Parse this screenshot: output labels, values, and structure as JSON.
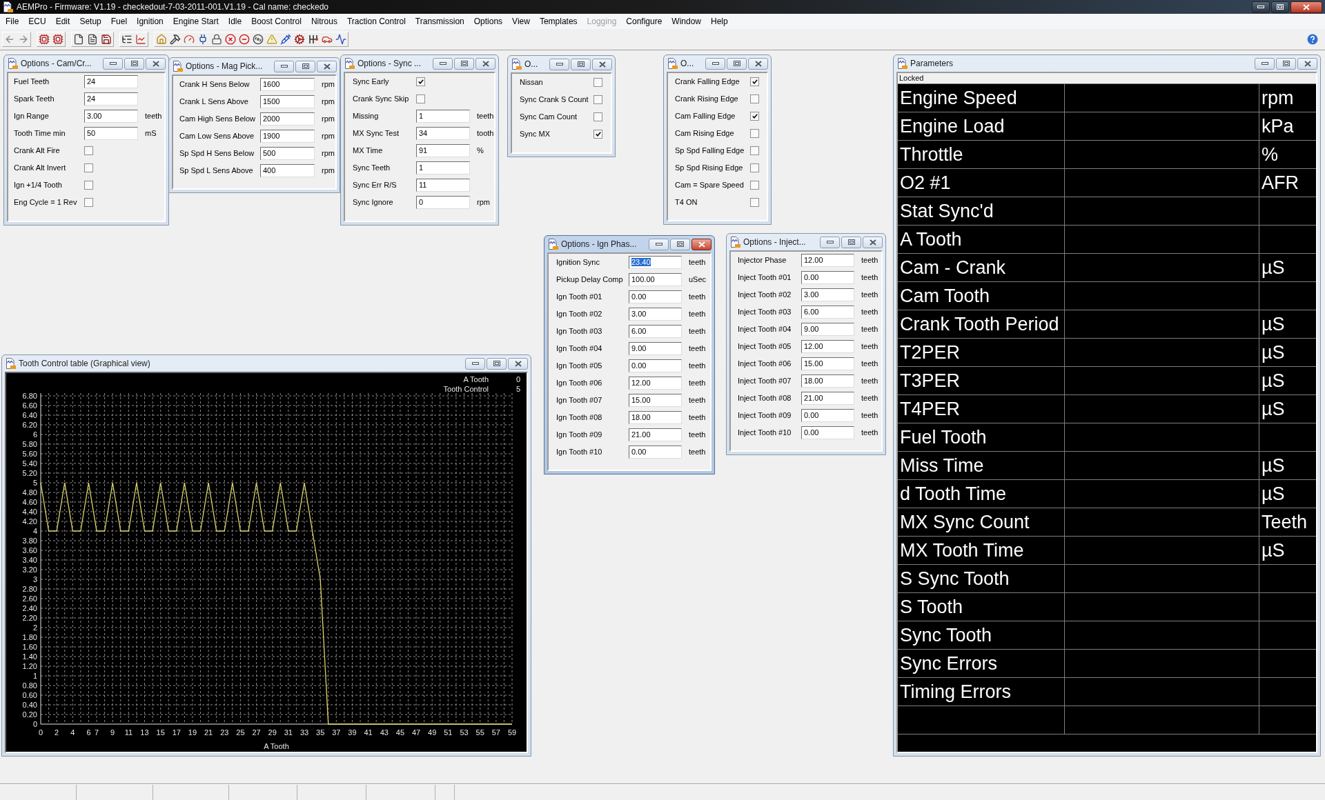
{
  "window": {
    "title": "AEMPro - Firmware: V1.19 - checkedout-7-03-2011-001.V1.19 - Cal name: checkedo"
  },
  "menu": [
    {
      "label": "File",
      "disabled": false
    },
    {
      "label": "ECU",
      "disabled": false
    },
    {
      "label": "Edit",
      "disabled": false
    },
    {
      "label": "Setup",
      "disabled": false
    },
    {
      "label": "Fuel",
      "disabled": false
    },
    {
      "label": "Ignition",
      "disabled": false
    },
    {
      "label": "Engine Start",
      "disabled": false
    },
    {
      "label": "Idle",
      "disabled": false
    },
    {
      "label": "Boost Control",
      "disabled": false
    },
    {
      "label": "Nitrous",
      "disabled": false
    },
    {
      "label": "Traction Control",
      "disabled": false
    },
    {
      "label": "Transmission",
      "disabled": false
    },
    {
      "label": "Options",
      "disabled": false
    },
    {
      "label": "View",
      "disabled": false
    },
    {
      "label": "Templates",
      "disabled": false
    },
    {
      "label": "Logging",
      "disabled": true
    },
    {
      "label": "Configure",
      "disabled": false
    },
    {
      "label": "Window",
      "disabled": false
    },
    {
      "label": "Help",
      "disabled": false
    }
  ],
  "option_windows": [
    {
      "title": "Options - Cam/Cr...",
      "active": false,
      "rows": [
        {
          "kind": "field",
          "label": "Fuel Teeth",
          "value": "24"
        },
        {
          "kind": "field",
          "label": "Spark Teeth",
          "value": "24"
        },
        {
          "kind": "field",
          "label": "Ign Range",
          "value": "3.00",
          "unit": "teeth"
        },
        {
          "kind": "field",
          "label": "Tooth Time min",
          "value": "50",
          "unit": "mS"
        },
        {
          "kind": "checkbox",
          "label": "Crank Alt Fire",
          "checked": false
        },
        {
          "kind": "checkbox",
          "label": "Crank Alt Invert",
          "checked": false
        },
        {
          "kind": "checkbox",
          "label": "Ign +1/4 Tooth",
          "checked": false
        },
        {
          "kind": "checkbox",
          "label": "Eng Cycle = 1 Rev",
          "checked": false
        }
      ]
    },
    {
      "title": "Options - Mag Pick...",
      "active": false,
      "rows": [
        {
          "kind": "field",
          "label": "Crank H Sens Below",
          "value": "1600",
          "unit": "rpm"
        },
        {
          "kind": "field",
          "label": "Crank L Sens Above",
          "value": "1500",
          "unit": "rpm"
        },
        {
          "kind": "field",
          "label": "Cam High Sens Below",
          "value": "2000",
          "unit": "rpm"
        },
        {
          "kind": "field",
          "label": "Cam Low Sens Above",
          "value": "1900",
          "unit": "rpm"
        },
        {
          "kind": "field",
          "label": "Sp Spd H Sens Below",
          "value": "500",
          "unit": "rpm"
        },
        {
          "kind": "field",
          "label": "Sp Spd L Sens Above",
          "value": "400",
          "unit": "rpm"
        }
      ]
    },
    {
      "title": "Options - Sync ...",
      "active": false,
      "rows": [
        {
          "kind": "checkbox",
          "label": "Sync Early",
          "checked": true
        },
        {
          "kind": "checkbox",
          "label": "Crank Sync Skip",
          "checked": false
        },
        {
          "kind": "field",
          "label": "Missing",
          "value": "1",
          "unit": "teeth"
        },
        {
          "kind": "field",
          "label": "MX Sync Test",
          "value": "34",
          "unit": "tooth"
        },
        {
          "kind": "field",
          "label": "MX Time",
          "value": "91",
          "unit": "%"
        },
        {
          "kind": "field",
          "label": "Sync Teeth",
          "value": "1"
        },
        {
          "kind": "field",
          "label": "Sync Err R/S",
          "value": "11"
        },
        {
          "kind": "field",
          "label": "Sync Ignore",
          "value": "0",
          "unit": "rpm"
        }
      ]
    },
    {
      "title": "O...",
      "active": false,
      "rows": [
        {
          "kind": "checkbox",
          "label": "Nissan",
          "checked": false
        },
        {
          "kind": "checkbox",
          "label": "Sync Crank S Count",
          "checked": false
        },
        {
          "kind": "checkbox",
          "label": "Sync Cam Count",
          "checked": false
        },
        {
          "kind": "checkbox",
          "label": "Sync MX",
          "checked": true
        }
      ]
    },
    {
      "title": "O...",
      "active": false,
      "rows": [
        {
          "kind": "checkbox",
          "label": "Crank Falling Edge",
          "checked": true
        },
        {
          "kind": "checkbox",
          "label": "Crank Rising Edge",
          "checked": false
        },
        {
          "kind": "checkbox",
          "label": "Cam Falling Edge",
          "checked": true
        },
        {
          "kind": "checkbox",
          "label": "Cam Rising Edge",
          "checked": false
        },
        {
          "kind": "checkbox",
          "label": "Sp Spd Falling Edge",
          "checked": false
        },
        {
          "kind": "checkbox",
          "label": "Sp Spd Rising Edge",
          "checked": false
        },
        {
          "kind": "checkbox",
          "label": "Cam = Spare Speed",
          "checked": false
        },
        {
          "kind": "checkbox",
          "label": "T4 ON",
          "checked": false
        }
      ]
    },
    {
      "title": "Options - Ign Phas...",
      "active": true,
      "rows": [
        {
          "kind": "field",
          "label": "Ignition Sync",
          "value": "23.40",
          "unit": "teeth",
          "selected": true
        },
        {
          "kind": "field",
          "label": "Pickup Delay Comp",
          "value": "100.00",
          "unit": "uSec",
          "selected": false
        },
        {
          "kind": "field",
          "label": "Ign Tooth #01",
          "value": "0.00",
          "unit": "teeth",
          "selected": false
        },
        {
          "kind": "field",
          "label": "Ign Tooth #02",
          "value": "3.00",
          "unit": "teeth",
          "selected": false
        },
        {
          "kind": "field",
          "label": "Ign Tooth #03",
          "value": "6.00",
          "unit": "teeth",
          "selected": false
        },
        {
          "kind": "field",
          "label": "Ign Tooth #04",
          "value": "9.00",
          "unit": "teeth",
          "selected": false
        },
        {
          "kind": "field",
          "label": "Ign Tooth #05",
          "value": "0.00",
          "unit": "teeth",
          "selected": false
        },
        {
          "kind": "field",
          "label": "Ign Tooth #06",
          "value": "12.00",
          "unit": "teeth",
          "selected": false
        },
        {
          "kind": "field",
          "label": "Ign Tooth #07",
          "value": "15.00",
          "unit": "teeth",
          "selected": false
        },
        {
          "kind": "field",
          "label": "Ign Tooth #08",
          "value": "18.00",
          "unit": "teeth",
          "selected": false
        },
        {
          "kind": "field",
          "label": "Ign Tooth #09",
          "value": "21.00",
          "unit": "teeth",
          "selected": false
        },
        {
          "kind": "field",
          "label": "Ign Tooth #10",
          "value": "0.00",
          "unit": "teeth",
          "selected": false
        }
      ]
    },
    {
      "title": "Options - Inject...",
      "active": false,
      "rows": [
        {
          "kind": "field",
          "label": "Injector Phase",
          "value": "12.00",
          "unit": "teeth"
        },
        {
          "kind": "field",
          "label": "Inject Tooth #01",
          "value": "0.00",
          "unit": "teeth"
        },
        {
          "kind": "field",
          "label": "Inject Tooth #02",
          "value": "3.00",
          "unit": "teeth"
        },
        {
          "kind": "field",
          "label": "Inject Tooth #03",
          "value": "6.00",
          "unit": "teeth"
        },
        {
          "kind": "field",
          "label": "Inject Tooth #04",
          "value": "9.00",
          "unit": "teeth"
        },
        {
          "kind": "field",
          "label": "Inject Tooth #05",
          "value": "12.00",
          "unit": "teeth"
        },
        {
          "kind": "field",
          "label": "Inject Tooth #06",
          "value": "15.00",
          "unit": "teeth"
        },
        {
          "kind": "field",
          "label": "Inject Tooth #07",
          "value": "18.00",
          "unit": "teeth"
        },
        {
          "kind": "field",
          "label": "Inject Tooth #08",
          "value": "21.00",
          "unit": "teeth"
        },
        {
          "kind": "field",
          "label": "Inject Tooth #09",
          "value": "0.00",
          "unit": "teeth"
        },
        {
          "kind": "field",
          "label": "Inject Tooth #10",
          "value": "0.00",
          "unit": "teeth"
        }
      ]
    }
  ],
  "parameters_window": {
    "title": "Parameters",
    "active": false,
    "status": "Locked",
    "rows": [
      {
        "name": "Engine Speed",
        "unit": "rpm"
      },
      {
        "name": "Engine Load",
        "unit": "kPa"
      },
      {
        "name": "Throttle",
        "unit": "%"
      },
      {
        "name": "O2 #1",
        "unit": "AFR"
      },
      {
        "name": "Stat Sync'd"
      },
      {
        "name": "A Tooth"
      },
      {
        "name": "Cam - Crank",
        "unit": "µS"
      },
      {
        "name": "Cam Tooth"
      },
      {
        "name": "Crank Tooth Period",
        "unit": "µS"
      },
      {
        "name": "T2PER",
        "unit": "µS"
      },
      {
        "name": "T3PER",
        "unit": "µS"
      },
      {
        "name": "T4PER",
        "unit": "µS"
      },
      {
        "name": "Fuel Tooth"
      },
      {
        "name": "Miss Time",
        "unit": "µS"
      },
      {
        "name": "d Tooth Time",
        "unit": "µS"
      },
      {
        "name": "MX Sync Count",
        "unit": "Teeth"
      },
      {
        "name": "MX Tooth Time",
        "unit": "µS"
      },
      {
        "name": "S Sync Tooth"
      },
      {
        "name": "S Tooth"
      },
      {
        "name": "Sync Tooth"
      },
      {
        "name": "Sync Errors"
      },
      {
        "name": "Timing Errors"
      }
    ]
  },
  "chart_window": {
    "title": "Tooth Control table (Graphical view)",
    "active": false,
    "readouts": [
      {
        "label": "A Tooth",
        "value": "0"
      },
      {
        "label": "Tooth Control",
        "value": "5"
      }
    ],
    "chart_data": {
      "type": "line",
      "grid": true,
      "xlabel": "A Tooth",
      "x": [
        0,
        1,
        2,
        3,
        4,
        5,
        6,
        7,
        8,
        9,
        10,
        11,
        12,
        13,
        14,
        15,
        16,
        17,
        18,
        19,
        20,
        21,
        22,
        23,
        24,
        25,
        26,
        27,
        28,
        29,
        30,
        31,
        32,
        33,
        34,
        35,
        36,
        37,
        38,
        39,
        40,
        41,
        42,
        43,
        44,
        45,
        46,
        47,
        48,
        49,
        50,
        51,
        52,
        53,
        54,
        55,
        56,
        57,
        58,
        59
      ],
      "series": [
        {
          "color": "#dcd76a",
          "values": [
            5,
            4,
            4,
            5,
            4,
            4,
            5,
            4,
            4,
            5,
            4,
            4,
            5,
            4,
            4,
            5,
            4,
            4,
            5,
            4,
            4,
            5,
            4,
            4,
            5,
            4,
            4,
            5,
            4,
            4,
            5,
            4,
            4,
            5,
            4,
            3,
            0,
            0,
            0,
            0,
            0,
            0,
            0,
            0,
            0,
            0,
            0,
            0,
            0,
            0,
            0,
            0,
            0,
            0,
            0,
            0,
            0,
            0,
            0,
            0
          ]
        }
      ],
      "xlim": [
        0,
        59
      ],
      "ylim": [
        0,
        6.8
      ],
      "xticks": [
        0,
        2,
        4,
        6,
        7,
        9,
        11,
        13,
        15,
        17,
        19,
        21,
        23,
        25,
        27,
        29,
        31,
        33,
        35,
        37,
        39,
        41,
        43,
        45,
        47,
        49,
        51,
        53,
        55,
        57,
        59
      ],
      "yticks": [
        0,
        {
          "value": 0.2,
          "label": "0.20"
        },
        {
          "value": 0.4,
          "label": "0.40"
        },
        {
          "value": 0.6,
          "label": "0.60"
        },
        {
          "value": 0.8,
          "label": "0.80"
        },
        1,
        {
          "value": 1.2,
          "label": "1.20"
        },
        {
          "value": 1.4,
          "label": "1.40"
        },
        {
          "value": 1.6,
          "label": "1.60"
        },
        {
          "value": 1.8,
          "label": "1.80"
        },
        2,
        {
          "value": 2.2,
          "label": "2.20"
        },
        {
          "value": 2.4,
          "label": "2.40"
        },
        {
          "value": 2.6,
          "label": "2.60"
        },
        {
          "value": 2.8,
          "label": "2.80"
        },
        3,
        {
          "value": 3.2,
          "label": "3.20"
        },
        {
          "value": 3.4,
          "label": "3.40"
        },
        {
          "value": 3.6,
          "label": "3.60"
        },
        {
          "value": 3.8,
          "label": "3.80"
        },
        4,
        {
          "value": 4.2,
          "label": "4.20"
        },
        {
          "value": 4.4,
          "label": "4.40"
        },
        {
          "value": 4.6,
          "label": "4.60"
        },
        {
          "value": 4.8,
          "label": "4.80"
        },
        5,
        {
          "value": 5.2,
          "label": "5.20"
        },
        {
          "value": 5.4,
          "label": "5.40"
        },
        {
          "value": 5.6,
          "label": "5.60"
        },
        {
          "value": 5.8,
          "label": "5.80"
        },
        6,
        {
          "value": 6.2,
          "label": "6.20"
        },
        {
          "value": 6.4,
          "label": "6.40"
        },
        {
          "value": 6.6,
          "label": "6.60"
        },
        {
          "value": 6.8,
          "label": "6.80"
        }
      ]
    }
  }
}
